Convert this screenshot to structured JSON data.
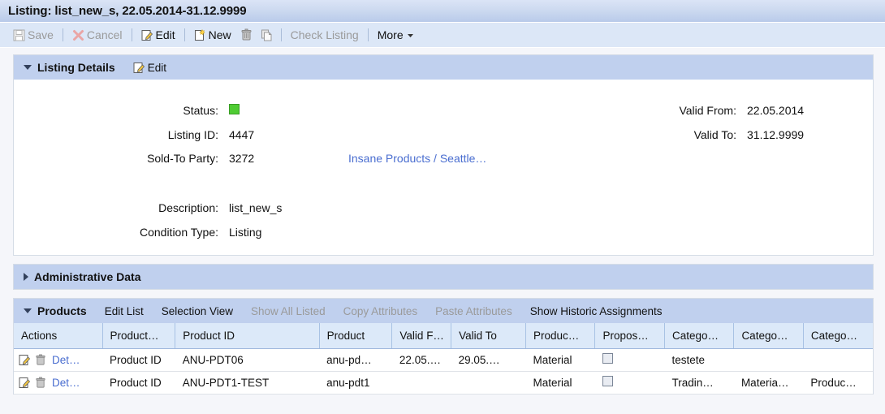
{
  "titlebar": {
    "title": "Listing: list_new_s, 22.05.2014-31.12.9999"
  },
  "toolbar": {
    "save_label": "Save",
    "cancel_label": "Cancel",
    "edit_label": "Edit",
    "new_label": "New",
    "delete_icon_name": "trash-icon",
    "copy_icon_name": "copy-icon",
    "check_listing_label": "Check Listing",
    "more_label": "More"
  },
  "listing_details": {
    "section_title": "Listing Details",
    "edit_label": "Edit",
    "fields": {
      "status_label": "Status:",
      "status_color": "#4fcc33",
      "listing_id_label": "Listing ID:",
      "listing_id_value": "4447",
      "sold_to_party_label": "Sold-To Party:",
      "sold_to_party_value": "3272",
      "sold_to_party_link": "Insane Products / Seattle…",
      "valid_from_label": "Valid From:",
      "valid_from_value": "22.05.2014",
      "valid_to_label": "Valid To:",
      "valid_to_value": "31.12.9999",
      "description_label": "Description:",
      "description_value": "list_new_s",
      "condition_type_label": "Condition Type:",
      "condition_type_value": "Listing"
    }
  },
  "administrative_data": {
    "section_title": "Administrative Data"
  },
  "products": {
    "section_title": "Products",
    "actions": [
      {
        "label": "Edit List",
        "disabled": false
      },
      {
        "label": "Selection View",
        "disabled": false
      },
      {
        "label": "Show All Listed",
        "disabled": true
      },
      {
        "label": "Copy Attributes",
        "disabled": true
      },
      {
        "label": "Paste Attributes",
        "disabled": true
      },
      {
        "label": "Show Historic Assignments",
        "disabled": false
      }
    ],
    "columns": [
      "Actions",
      "Product…",
      "Product ID",
      "Product",
      "Valid F…",
      "Valid To",
      "Produc…",
      "Propos…",
      "Catego…",
      "Catego…",
      "Catego…"
    ],
    "row_action_details_label": "Det…",
    "rows": [
      {
        "product_type": "Product ID",
        "product_id": "ANU-PDT06",
        "product": "anu-pd…",
        "valid_from": "22.05.…",
        "valid_to": "29.05.…",
        "product_category": "Material",
        "proposed": "",
        "category1": "testete",
        "category2": "",
        "category3": ""
      },
      {
        "product_type": "Product ID",
        "product_id": "ANU-PDT1-TEST",
        "product": "anu-pdt1",
        "valid_from": "",
        "valid_to": "",
        "product_category": "Material",
        "proposed": "",
        "category1": "Tradin…",
        "category2": "Materia…",
        "category3": "Produc…"
      }
    ]
  }
}
